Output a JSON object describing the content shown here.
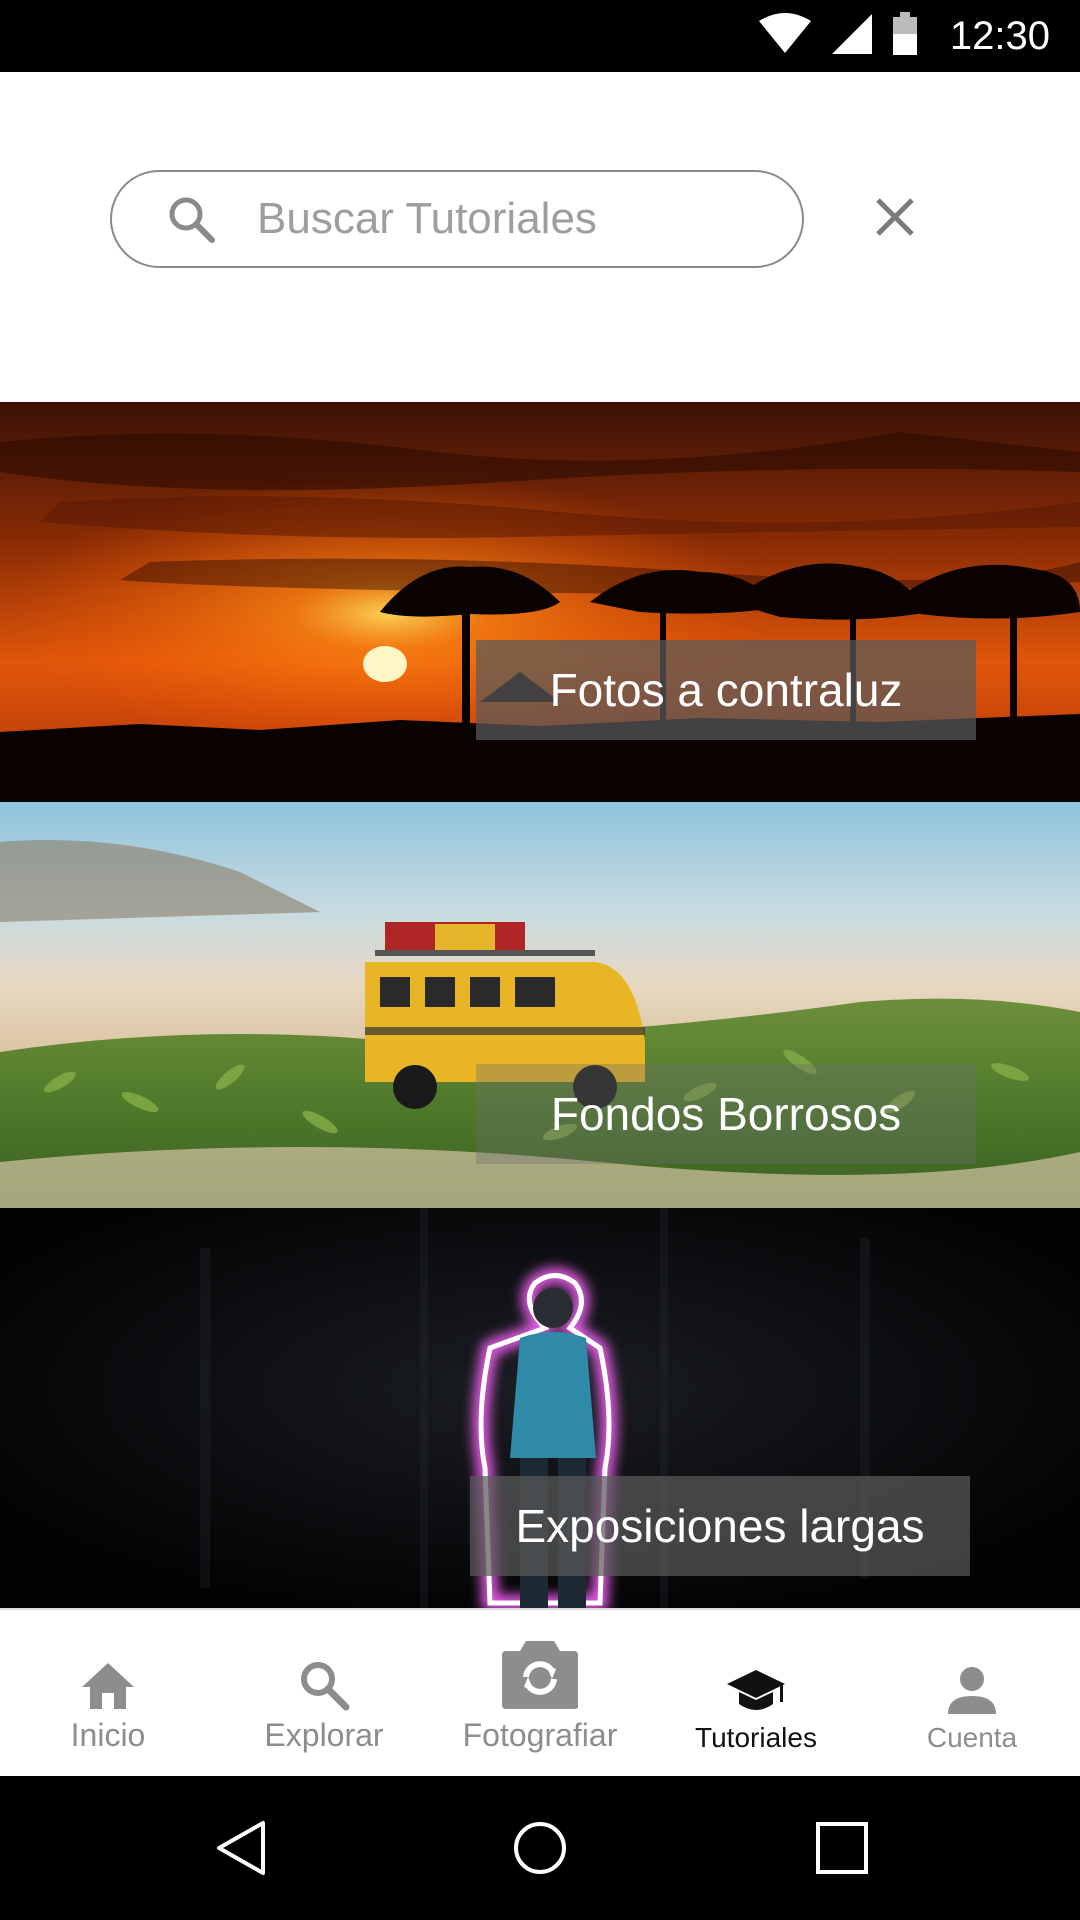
{
  "status_bar": {
    "time": "12:30",
    "icons": [
      "wifi-icon",
      "cellular-signal-icon",
      "battery-icon"
    ]
  },
  "search": {
    "placeholder": "Buscar Tutoriales",
    "value": "",
    "icon": "search-icon",
    "clear_icon": "close-icon"
  },
  "tutorials": [
    {
      "title": "Fotos a contraluz",
      "image": "sunset-savanna-photo"
    },
    {
      "title": "Fondos Borrosos",
      "image": "toy-bus-beach-photo"
    },
    {
      "title": "Exposiciones largas",
      "image": "light-painting-person-photo"
    }
  ],
  "bottom_nav": {
    "active": "Tutoriales",
    "items": [
      {
        "label": "Inicio",
        "icon": "home-icon"
      },
      {
        "label": "Explorar",
        "icon": "search-icon"
      },
      {
        "label": "Fotografiar",
        "icon": "camera-switch-icon"
      },
      {
        "label": "Tutoriales",
        "icon": "graduation-cap-icon"
      },
      {
        "label": "Cuenta",
        "icon": "person-icon"
      }
    ]
  },
  "system_nav": {
    "buttons": [
      "back-icon",
      "home-circle-icon",
      "recents-icon"
    ]
  },
  "colors": {
    "status_bar": "#000000",
    "label_overlay": "#5a5a5a",
    "nav_inactive": "#8d8d8d",
    "nav_active": "#111111"
  }
}
